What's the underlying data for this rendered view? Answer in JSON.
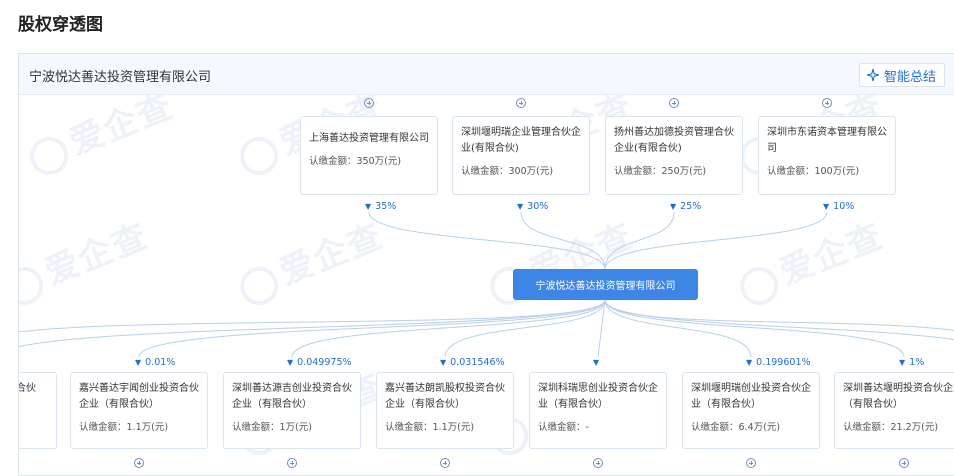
{
  "page_title": "股权穿透图",
  "panel": {
    "company": "宁波悦达善达投资管理有限公司",
    "smart_summary": "智能总结"
  },
  "watermark": "爱企查",
  "center": "宁波悦达善达投资管理有限公司",
  "shareholders": [
    {
      "name": "上海善达投资管理有限公司",
      "amount": "认缴金额：350万(元)",
      "pct": "35%"
    },
    {
      "name": "深圳堰明瑞企业管理合伙企业(有限合伙)",
      "amount": "认缴金额：300万(元)",
      "pct": "30%"
    },
    {
      "name": "扬州善达加德投资管理合伙企业(有限合伙)",
      "amount": "认缴金额：250万(元)",
      "pct": "25%"
    },
    {
      "name": "深圳市东诺资本管理有限公司",
      "amount": "认缴金额：100万(元)",
      "pct": "10%"
    }
  ],
  "investments": [
    {
      "name": "合伙",
      "amount": "",
      "pct": ""
    },
    {
      "name": "嘉兴善达宇闻创业投资合伙企业（有限合伙）",
      "amount": "认缴金额：1.1万(元)",
      "pct": "0.01%"
    },
    {
      "name": "深圳善达源吉创业投资合伙企业（有限合伙）",
      "amount": "认缴金额：1万(元)",
      "pct": "0.049975%"
    },
    {
      "name": "嘉兴善达朗凯股权投资合伙企业（有限合伙）",
      "amount": "认缴金额：1.1万(元)",
      "pct": "0.031546%"
    },
    {
      "name": "深圳科瑞思创业投资合伙企业（有限合伙）",
      "amount": "认缴金额：-",
      "pct": ""
    },
    {
      "name": "深圳堰明瑞创业投资合伙企业（有限合伙）",
      "amount": "认缴金额：6.4万(元)",
      "pct": "0.199601%"
    },
    {
      "name": "深圳善达堰明投资合伙企业（有限合伙）",
      "amount": "认缴金额：21.2万(元)",
      "pct": "1%"
    }
  ]
}
